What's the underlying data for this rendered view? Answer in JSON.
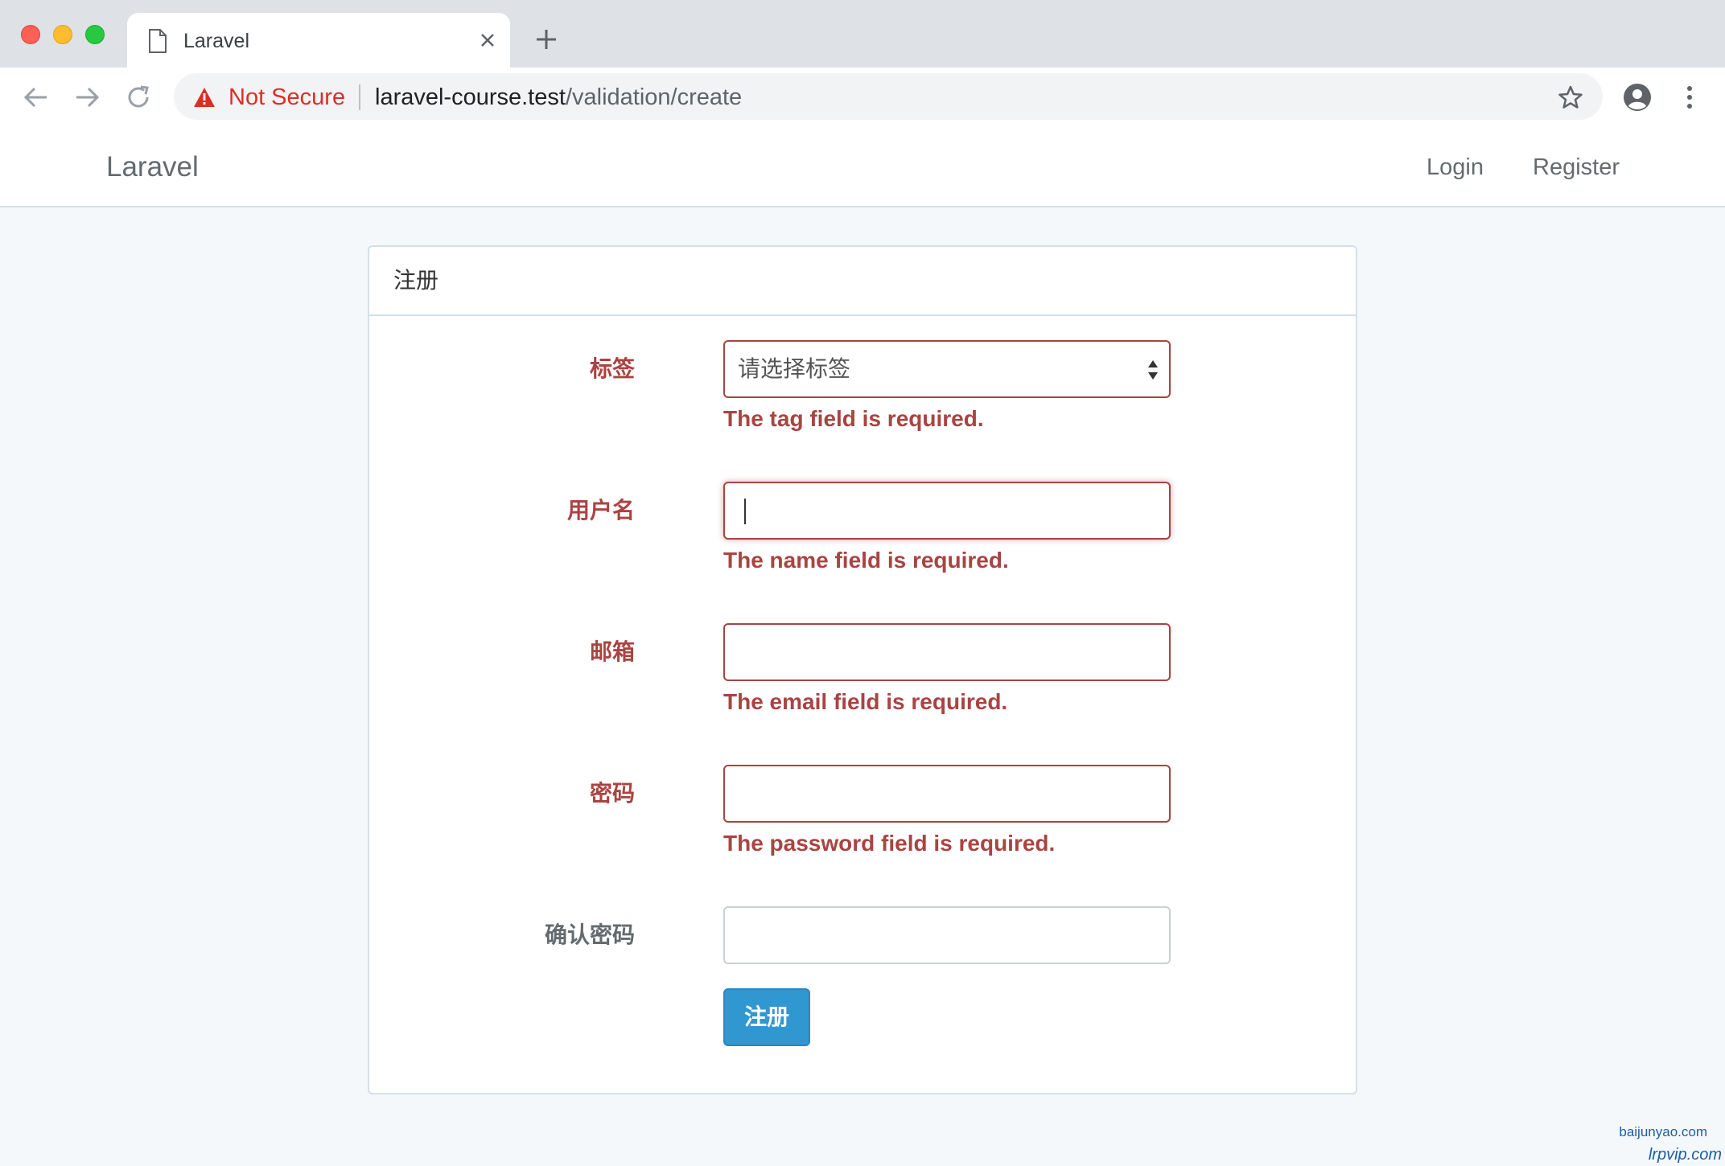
{
  "browser": {
    "tab_title": "Laravel",
    "security_label": "Not Secure",
    "url_host": "laravel-course.test",
    "url_path": "/validation/create"
  },
  "navbar": {
    "brand": "Laravel",
    "links": [
      "Login",
      "Register"
    ]
  },
  "panel": {
    "title": "注册",
    "fields": [
      {
        "label": "标签",
        "type": "select",
        "value": "请选择标签",
        "error": "The tag field is required."
      },
      {
        "label": "用户名",
        "type": "text",
        "value": "",
        "error": "The name field is required."
      },
      {
        "label": "邮箱",
        "type": "email",
        "value": "",
        "error": "The email field is required."
      },
      {
        "label": "密码",
        "type": "password",
        "value": "",
        "error": "The password field is required."
      },
      {
        "label": "确认密码",
        "type": "password",
        "value": "",
        "error": ""
      }
    ],
    "submit_label": "注册"
  },
  "watermark": {
    "line1": "baijunyao.com",
    "line2": "lrpvip.com"
  },
  "colors": {
    "error": "#a94442",
    "primary": "#3097d1",
    "page_bg": "#f5f8fa",
    "not_secure": "#d93025"
  }
}
